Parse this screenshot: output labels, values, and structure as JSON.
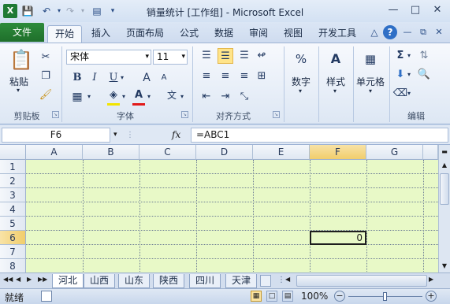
{
  "window": {
    "title": "销量统计  [工作组]  -  Microsoft Excel",
    "controls": [
      "—",
      "□",
      "✕"
    ]
  },
  "tabs": [
    "文件",
    "开始",
    "插入",
    "页面布局",
    "公式",
    "数据",
    "审阅",
    "视图",
    "开发工具"
  ],
  "ribbon": {
    "clipboard": {
      "paste": "粘贴",
      "label": "剪贴板"
    },
    "font": {
      "name": "宋体",
      "size": "11",
      "bold": "B",
      "italic": "I",
      "underline": "U",
      "label": "字体",
      "grow": "A",
      "shrink": "A",
      "font_color": "A",
      "phonetic": "文"
    },
    "alignment": {
      "label": "对齐方式"
    },
    "number": {
      "label": "数字"
    },
    "styles": {
      "label": "样式"
    },
    "cells": {
      "label": "单元格"
    },
    "editing": {
      "label": "编辑"
    }
  },
  "formula_bar": {
    "name_box": "F6",
    "fx": "fx",
    "content": "=ABC1"
  },
  "grid": {
    "columns": [
      "A",
      "B",
      "C",
      "D",
      "E",
      "F",
      "G"
    ],
    "rows": [
      "1",
      "2",
      "3",
      "4",
      "5",
      "6",
      "7",
      "8"
    ],
    "cells": {
      "F6": "0"
    },
    "fill_color": "#e8f9c7"
  },
  "sheets": [
    "河北",
    "山西",
    "山东",
    "陕西",
    "四川",
    "天津"
  ],
  "status": {
    "ready": "就绪",
    "zoom": "100%"
  }
}
